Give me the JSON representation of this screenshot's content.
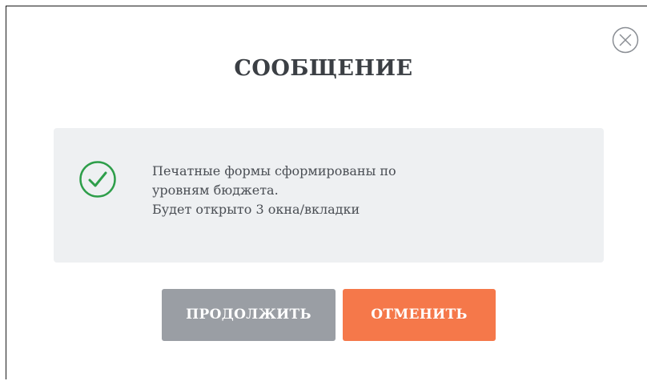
{
  "dialog": {
    "title": "СООБЩЕНИЕ",
    "close_icon": "close-circle-icon",
    "message": {
      "status_icon": "check-circle-icon",
      "lines": [
        "Печатные формы сформированы по",
        "уровням бюджета.",
        "Будет открыто 3 окна/вкладки"
      ]
    },
    "buttons": {
      "continue_label": "ПРОДОЛЖИТЬ",
      "cancel_label": "ОТМЕНИТЬ"
    }
  },
  "colors": {
    "title": "#3b3f44",
    "message_bg": "#eef0f2",
    "success": "#2e9e4a",
    "continue_bg": "#9a9ea4",
    "cancel_bg": "#f5784a"
  }
}
